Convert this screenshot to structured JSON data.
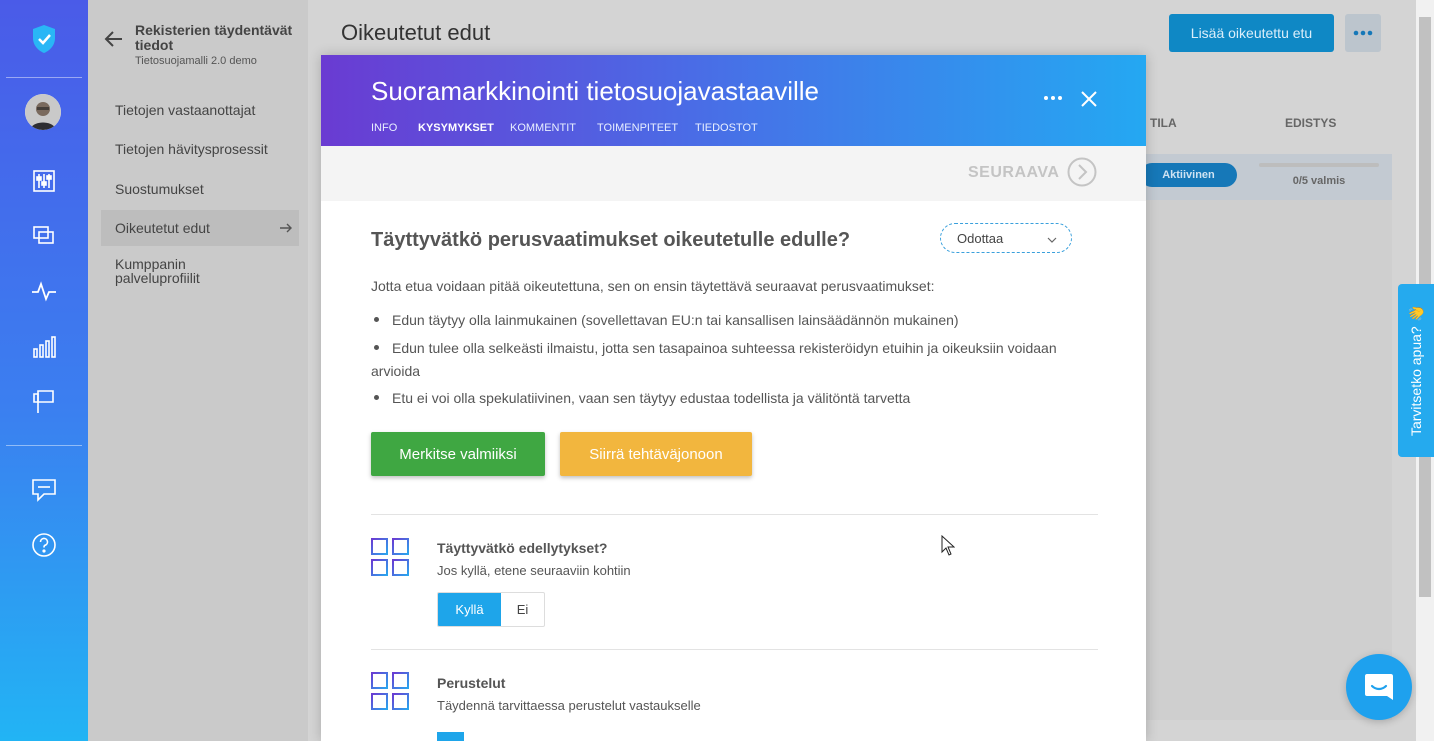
{
  "sidebar": {
    "title": "Rekisterien täydentävät tiedot",
    "subtitle": "Tietosuojamalli 2.0 demo",
    "items": [
      {
        "label": "Tietojen vastaanottajat"
      },
      {
        "label": "Tietojen hävitysprosessit"
      },
      {
        "label": "Suostumukset"
      },
      {
        "label": "Oikeutetut edut"
      },
      {
        "label": "Kumppanin palveluprofiilit"
      }
    ],
    "active_item": "Oikeutetut edut"
  },
  "rail": {
    "icons": [
      "shield-check-icon",
      "avatar",
      "sliders-icon",
      "windows-icon",
      "activity-icon",
      "bar-chart-icon",
      "flag-icon",
      "chat-icon",
      "help-icon"
    ]
  },
  "page": {
    "title": "Oikeutetut edut",
    "add_button": "Lisää oikeutettu etu",
    "columns": {
      "status": "TILA",
      "progress": "EDISTYS"
    },
    "row": {
      "status": "Aktiivinen",
      "progress_text": "0/5 valmis",
      "progress_fraction": 0
    }
  },
  "modal": {
    "title": "Suoramarkkinointi tietosuojavastaaville",
    "tabs": [
      "INFO",
      "KYSYMYKSET",
      "KOMMENTIT",
      "TOIMENPITEET",
      "TIEDOSTOT"
    ],
    "active_tab": "KYSYMYKSET",
    "next_label": "SEURAAVA",
    "question": {
      "title": "Täyttyvätkö perusvaatimukset oikeutetulle edulle?",
      "status_value": "Odottaa",
      "intro": "Jotta etua voidaan pitää oikeutettuna, sen on ensin täytettävä seuraavat perusvaatimukset:",
      "bullets": [
        "Edun täytyy olla lainmukainen (sovellettavan EU:n tai kansallisen lainsäädännön mukainen)",
        "Edun tulee olla selkeästi ilmaistu, jotta sen tasapainoa suhteessa rekisteröidyn etuihin ja oikeuksiin voidaan arvioida",
        "Etu ei voi olla spekulatiivinen, vaan sen täytyy edustaa todellista ja välitöntä tarvetta"
      ],
      "mark_done_button": "Merkitse valmiiksi",
      "move_queue_button": "Siirrä tehtäväjonoon"
    },
    "subquestions": [
      {
        "title": "Täyttyvätkö edellytykset?",
        "text": "Jos kyllä, etene seuraaviin kohtiin",
        "options": [
          "Kyllä",
          "Ei"
        ],
        "selected": "Kyllä"
      },
      {
        "title": "Perustelut",
        "text": "Täydennä tarvittaessa perustelut vastaukselle"
      }
    ]
  },
  "help_tab": {
    "label": "Tarvitsetko apua? 👋"
  },
  "colors": {
    "accent": "#1ea5ea",
    "green": "#3fa742",
    "amber": "#f2b63e",
    "header_from": "#6a3bd2",
    "header_to": "#24a8f2"
  }
}
